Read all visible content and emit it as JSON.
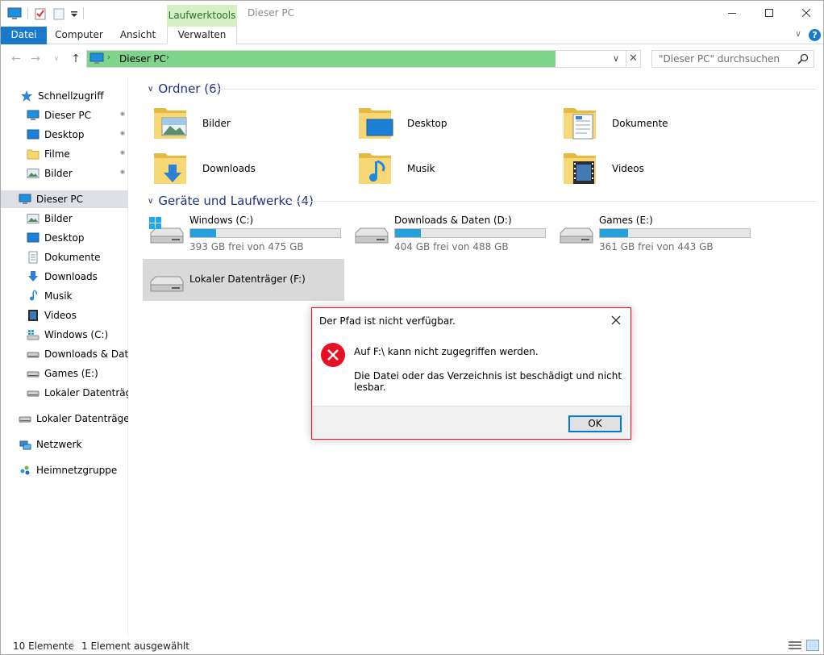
{
  "titlebar": {
    "context_tab": "Laufwerktools",
    "window_title": "Dieser PC"
  },
  "ribbon": {
    "tabs": [
      "Datei",
      "Computer",
      "Ansicht",
      "Verwalten"
    ]
  },
  "address": {
    "path_root": "Dieser PC",
    "search_placeholder": "\"Dieser PC\" durchsuchen",
    "progress_fill_fraction": 0.87,
    "progress_color": "#7fd48c"
  },
  "nav": {
    "items": [
      {
        "label": "Schnellzugriff",
        "icon": "star-icon"
      },
      {
        "label": "Dieser PC",
        "icon": "computer-icon",
        "pinned": true
      },
      {
        "label": "Desktop",
        "icon": "desktop-icon",
        "pinned": true
      },
      {
        "label": "Filme",
        "icon": "folder-icon",
        "pinned": true
      },
      {
        "label": "Bilder",
        "icon": "pictures-icon",
        "pinned": true
      },
      {
        "label": "Dieser PC",
        "icon": "computer-icon",
        "selected": true
      },
      {
        "label": "Bilder",
        "icon": "pictures-icon"
      },
      {
        "label": "Desktop",
        "icon": "desktop-icon"
      },
      {
        "label": "Dokumente",
        "icon": "documents-icon"
      },
      {
        "label": "Downloads",
        "icon": "downloads-icon"
      },
      {
        "label": "Musik",
        "icon": "music-icon"
      },
      {
        "label": "Videos",
        "icon": "videos-icon"
      },
      {
        "label": "Windows (C:)",
        "icon": "windows-drive-icon"
      },
      {
        "label": "Downloads & Daten",
        "icon": "drive-icon"
      },
      {
        "label": "Games (E:)",
        "icon": "drive-icon"
      },
      {
        "label": "Lokaler Datenträger",
        "icon": "drive-icon"
      },
      {
        "label": "Lokaler Datenträger (",
        "icon": "drive-icon"
      },
      {
        "label": "Netzwerk",
        "icon": "network-icon"
      },
      {
        "label": "Heimnetzgruppe",
        "icon": "homegroup-icon"
      }
    ]
  },
  "folders": {
    "title": "Ordner (6)",
    "items": [
      {
        "label": "Bilder",
        "icon": "pictures-folder-icon"
      },
      {
        "label": "Desktop",
        "icon": "desktop-folder-icon"
      },
      {
        "label": "Dokumente",
        "icon": "documents-folder-icon"
      },
      {
        "label": "Downloads",
        "icon": "downloads-folder-icon"
      },
      {
        "label": "Musik",
        "icon": "music-folder-icon"
      },
      {
        "label": "Videos",
        "icon": "videos-folder-icon"
      }
    ]
  },
  "drives": {
    "title": "Geräte und Laufwerke (4)",
    "items": [
      {
        "name": "Windows (C:)",
        "free": "393 GB frei von 475 GB",
        "used_fraction": 0.17,
        "icon": "windows-drive-icon"
      },
      {
        "name": "Downloads & Daten (D:)",
        "free": "404 GB frei von 488 GB",
        "used_fraction": 0.17,
        "icon": "drive-icon"
      },
      {
        "name": "Games (E:)",
        "free": "361 GB frei von 443 GB",
        "used_fraction": 0.19,
        "icon": "drive-icon"
      },
      {
        "name": "Lokaler Datenträger (F:)",
        "icon": "drive-icon",
        "selected": true
      }
    ]
  },
  "status": {
    "count": "10 Elemente",
    "selection": "1 Element ausgewählt"
  },
  "dialog": {
    "title": "Der Pfad ist nicht verfügbar.",
    "message1": "Auf F:\\ kann nicht zugegriffen werden.",
    "message2": "Die Datei oder das Verzeichnis ist beschädigt und nicht lesbar.",
    "ok_label": "OK",
    "error_color": "#e81123"
  },
  "colors": {
    "accent": "#1979ca",
    "drive_bar": "#26a0da",
    "group_title": "#1e3287",
    "selection": "#d9d9d9"
  }
}
